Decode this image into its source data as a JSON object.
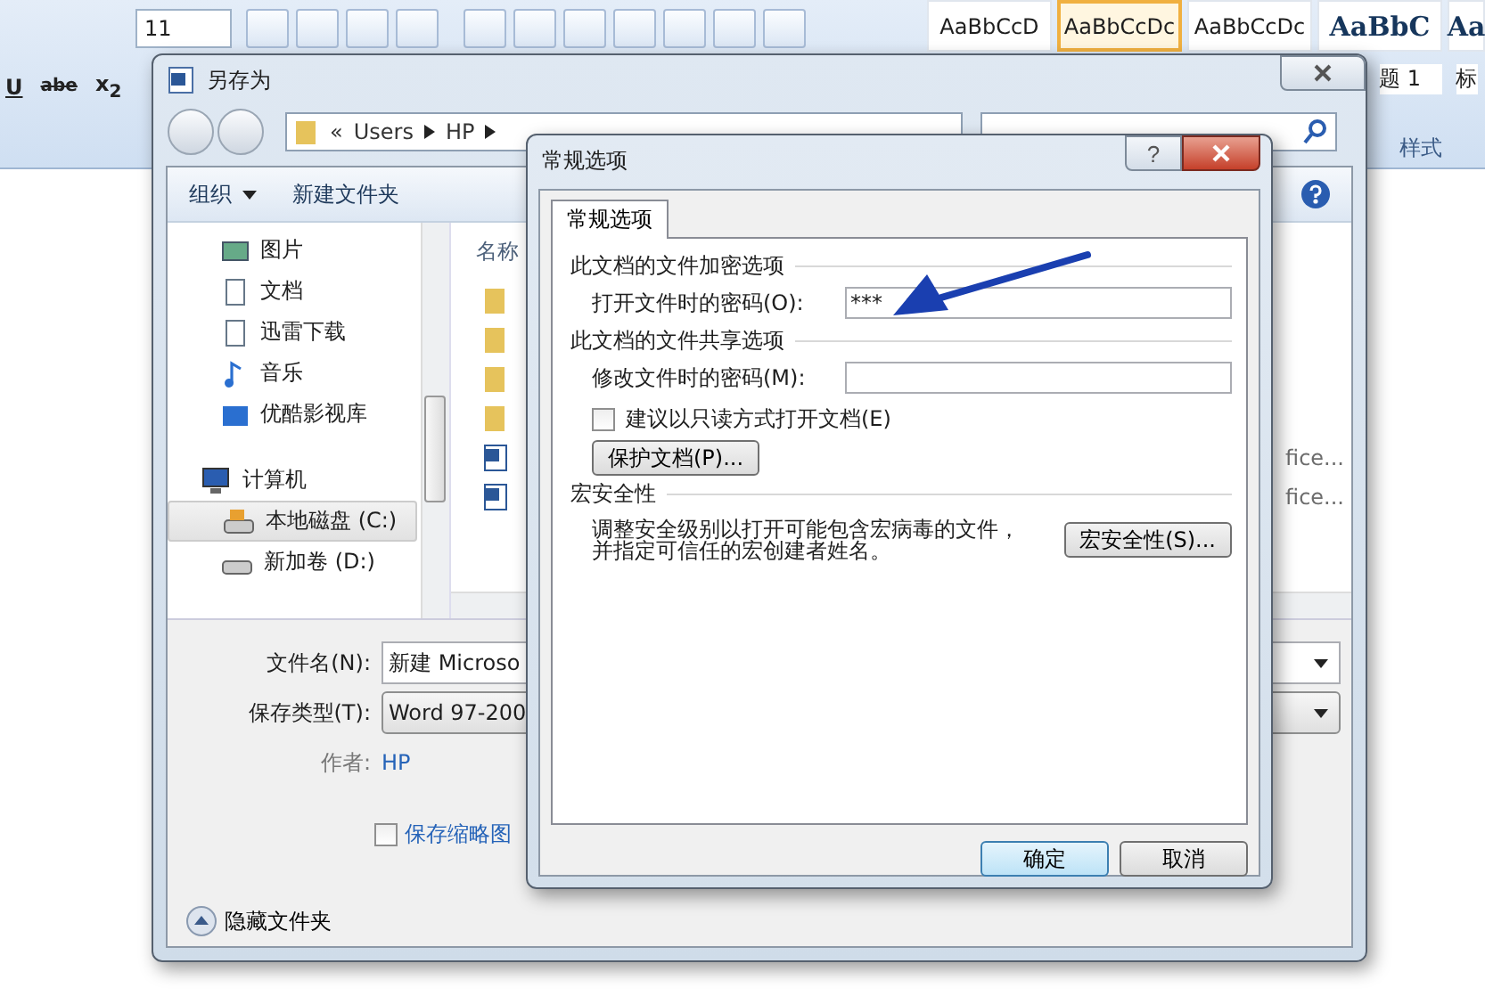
{
  "ribbon": {
    "font_size": "11",
    "format_marks": [
      "U",
      "abe",
      "x$_{2}$"
    ],
    "styles": [
      {
        "sample": "AaBbCcD",
        "selected": false
      },
      {
        "sample": "AaBbCcDc",
        "selected": true
      },
      {
        "sample": "AaBbCcDc",
        "selected": false
      },
      {
        "sample": "AaBbC",
        "name": "题 1",
        "selected": false,
        "kind": "heading"
      },
      {
        "sample": "Aa",
        "name": "标",
        "selected": false,
        "kind": "heading"
      }
    ],
    "group_label": "样式"
  },
  "save_dialog": {
    "title": "另存为",
    "breadcrumb": [
      "«",
      "Users",
      "HP"
    ],
    "toolbar": {
      "organize": "组织",
      "new_folder": "新建文件夹"
    },
    "sidebar": {
      "items": [
        {
          "label": "图片",
          "kind": "pictures"
        },
        {
          "label": "文档",
          "kind": "documents"
        },
        {
          "label": "迅雷下载",
          "kind": "downloads"
        },
        {
          "label": "音乐",
          "kind": "music"
        },
        {
          "label": "优酷影视库",
          "kind": "video"
        }
      ],
      "computer": {
        "label": "计算机",
        "children": [
          {
            "label": "本地磁盘 (C:)",
            "kind": "system-drive",
            "selected": true
          },
          {
            "label": "新加卷 (D:)",
            "kind": "drive",
            "selected": false
          }
        ]
      }
    },
    "file_list": {
      "column": "名称",
      "rows": [
        {
          "kind": "folder"
        },
        {
          "kind": "folder"
        },
        {
          "kind": "folder"
        },
        {
          "kind": "folder"
        },
        {
          "kind": "word",
          "type": "fice..."
        },
        {
          "kind": "word",
          "type": "fice..."
        }
      ]
    },
    "file_name": {
      "label": "文件名(N):",
      "value": "新建 Microso"
    },
    "save_type": {
      "label": "保存类型(T):",
      "value": "Word 97-200"
    },
    "author": {
      "label": "作者:",
      "value": "HP"
    },
    "thumbnail": {
      "label": "保存缩略图",
      "checked": false
    },
    "hide_folders": "隐藏文件夹"
  },
  "options_dialog": {
    "title": "常规选项",
    "help": "?",
    "tab": {
      "label": "常规选项",
      "selected": true
    },
    "encryption": {
      "heading": "此文档的文件加密选项",
      "label": "打开文件时的密码(O):",
      "value": "***"
    },
    "sharing": {
      "heading": "此文档的文件共享选项",
      "label": "修改文件时的密码(M):"
    },
    "read_only": {
      "label": "建议以只读方式打开文档(E)",
      "checked": false
    },
    "protect_button": "保护文档(P)...",
    "macro": {
      "heading": "宏安全性",
      "text": "调整安全级别以打开可能包含宏病毒的文件，并指定可信任的宏创建者姓名。",
      "button": "宏安全性(S)..."
    },
    "buttons": [
      {
        "label": "确定",
        "default": true
      },
      {
        "label": "取消",
        "default": false
      }
    ]
  }
}
